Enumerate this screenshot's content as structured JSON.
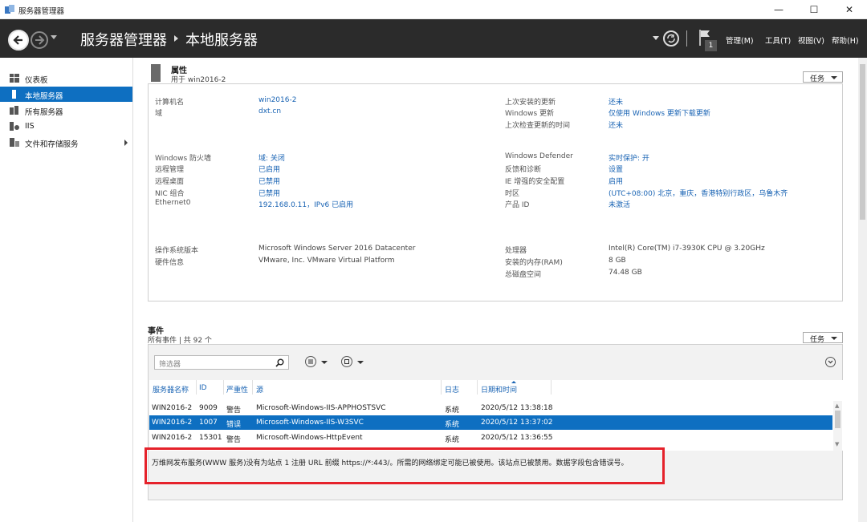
{
  "window": {
    "title": "服务器管理器",
    "minimize": "—",
    "maximize": "☐",
    "close": "✕"
  },
  "header": {
    "breadcrumb_root": "服务器管理器",
    "breadcrumb_current": "本地服务器",
    "notification_count": "1",
    "menu": [
      {
        "label": "管理(M)"
      },
      {
        "label": "工具(T)"
      },
      {
        "label": "视图(V)"
      },
      {
        "label": "帮助(H)"
      }
    ]
  },
  "sidebar": {
    "items": [
      {
        "label": "仪表板",
        "icon": "dashboard-icon"
      },
      {
        "label": "本地服务器",
        "icon": "server-icon",
        "active": true
      },
      {
        "label": "所有服务器",
        "icon": "servers-icon"
      },
      {
        "label": "IIS",
        "icon": "iis-icon"
      },
      {
        "label": "文件和存储服务",
        "icon": "storage-icon"
      }
    ]
  },
  "properties": {
    "title": "属性",
    "subtitle": "用于 win2016-2",
    "tasks_label": "任务",
    "left_groups": [
      [
        {
          "label": "计算机名",
          "value": "win2016-2"
        },
        {
          "label": "域",
          "value": "dxt.cn"
        }
      ],
      [
        {
          "label": "Windows 防火墙",
          "value": "域: 关闭"
        },
        {
          "label": "远程管理",
          "value": "已启用"
        },
        {
          "label": "远程桌面",
          "value": "已禁用"
        },
        {
          "label": "NIC 组合",
          "value": "已禁用"
        },
        {
          "label": "Ethernet0",
          "value": "192.168.0.11，IPv6 已启用"
        }
      ],
      [
        {
          "label": "操作系统版本",
          "value": "Microsoft Windows Server 2016 Datacenter"
        },
        {
          "label": "硬件信息",
          "value": "VMware, Inc. VMware Virtual Platform"
        }
      ]
    ],
    "right_groups": [
      [
        {
          "label": "上次安装的更新",
          "value": "还未"
        },
        {
          "label": "Windows 更新",
          "value": "仅使用 Windows 更新下载更新"
        },
        {
          "label": "上次检查更新的时间",
          "value": "还未"
        }
      ],
      [
        {
          "label": "Windows Defender",
          "value": "实时保护: 开"
        },
        {
          "label": "反馈和诊断",
          "value": "设置"
        },
        {
          "label": "IE 增强的安全配置",
          "value": "启用"
        },
        {
          "label": "时区",
          "value": "(UTC+08:00) 北京，重庆，香港特别行政区，乌鲁木齐"
        },
        {
          "label": "产品 ID",
          "value": "未激活"
        }
      ],
      [
        {
          "label": "处理器",
          "value": "Intel(R) Core(TM) i7-3930K CPU @ 3.20GHz"
        },
        {
          "label": "安装的内存(RAM)",
          "value": "8 GB"
        },
        {
          "label": "总磁盘空间",
          "value": "74.48 GB"
        }
      ]
    ]
  },
  "events": {
    "title": "事件",
    "subtitle": "所有事件 | 共 92 个",
    "tasks_label": "任务",
    "filter_placeholder": "筛选器",
    "columns": [
      "服务器名称",
      "ID",
      "严重性",
      "源",
      "日志",
      "日期和时间"
    ],
    "rows": [
      {
        "server": "WIN2016-2",
        "id": "9009",
        "severity": "警告",
        "source": "Microsoft-Windows-IIS-APPHOSTSVC",
        "log": "系统",
        "datetime": "2020/5/12 13:38:18"
      },
      {
        "server": "WIN2016-2",
        "id": "1007",
        "severity": "错误",
        "source": "Microsoft-Windows-IIS-W3SVC",
        "log": "系统",
        "datetime": "2020/5/12 13:37:02",
        "selected": true
      },
      {
        "server": "WIN2016-2",
        "id": "15301",
        "severity": "警告",
        "source": "Microsoft-Windows-HttpEvent",
        "log": "系统",
        "datetime": "2020/5/12 13:36:55"
      }
    ],
    "detail": "万维网发布服务(WWW 服务)没有为站点 1 注册 URL 前缀 https://*:443/。所需的网络绑定可能已被使用。该站点已被禁用。数据字段包含错误号。"
  },
  "colors": {
    "accent": "#0e6fc1",
    "link": "#1a64b4",
    "header_bg": "#2b2b2b",
    "highlight": "#e5222b"
  }
}
